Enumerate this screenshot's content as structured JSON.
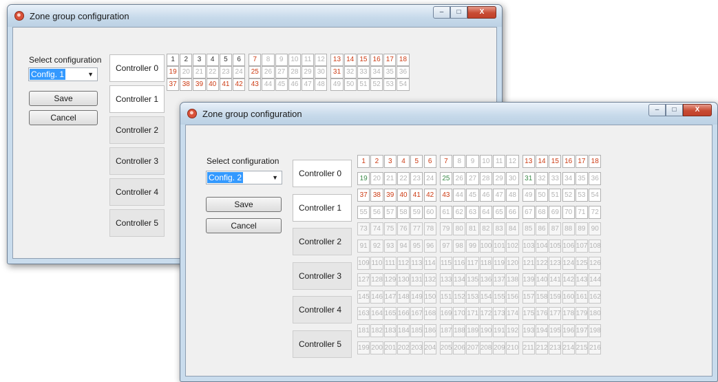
{
  "windows": [
    {
      "id": "back",
      "title": "Zone group configuration",
      "select_label": "Select configuration",
      "config_value": "Config. 1",
      "save_label": "Save",
      "cancel_label": "Cancel",
      "min_label": "–",
      "max_label": "□",
      "close_label": "X",
      "controllers": [
        "Controller 0",
        "Controller 1",
        "Controller 2",
        "Controller 3",
        "Controller 4",
        "Controller 5"
      ],
      "active_controllers": [
        0,
        1
      ],
      "zone_colors": {
        "black": [
          1,
          2,
          3,
          4,
          5,
          6
        ],
        "red": [
          7,
          13,
          14,
          15,
          16,
          17,
          18,
          19,
          25,
          31,
          37,
          38,
          39,
          40,
          41,
          42,
          43
        ]
      },
      "zones_visible": 54
    },
    {
      "id": "front",
      "title": "Zone group configuration",
      "select_label": "Select configuration",
      "config_value": "Config. 2",
      "save_label": "Save",
      "cancel_label": "Cancel",
      "min_label": "–",
      "max_label": "□",
      "close_label": "X",
      "controllers": [
        "Controller 0",
        "Controller 1",
        "Controller 2",
        "Controller 3",
        "Controller 4",
        "Controller 5"
      ],
      "active_controllers": [
        0,
        1
      ],
      "zone_colors": {
        "red": [
          1,
          2,
          3,
          4,
          5,
          6,
          7,
          13,
          14,
          15,
          16,
          17,
          18,
          37,
          38,
          39,
          40,
          41,
          42,
          43
        ],
        "green": [
          19,
          25,
          31
        ]
      },
      "zones_visible": 216
    }
  ],
  "colors": {
    "red": "#cc3a12",
    "green": "#3b8a49",
    "black": "#333333",
    "inactive": "#b4b4b4"
  }
}
